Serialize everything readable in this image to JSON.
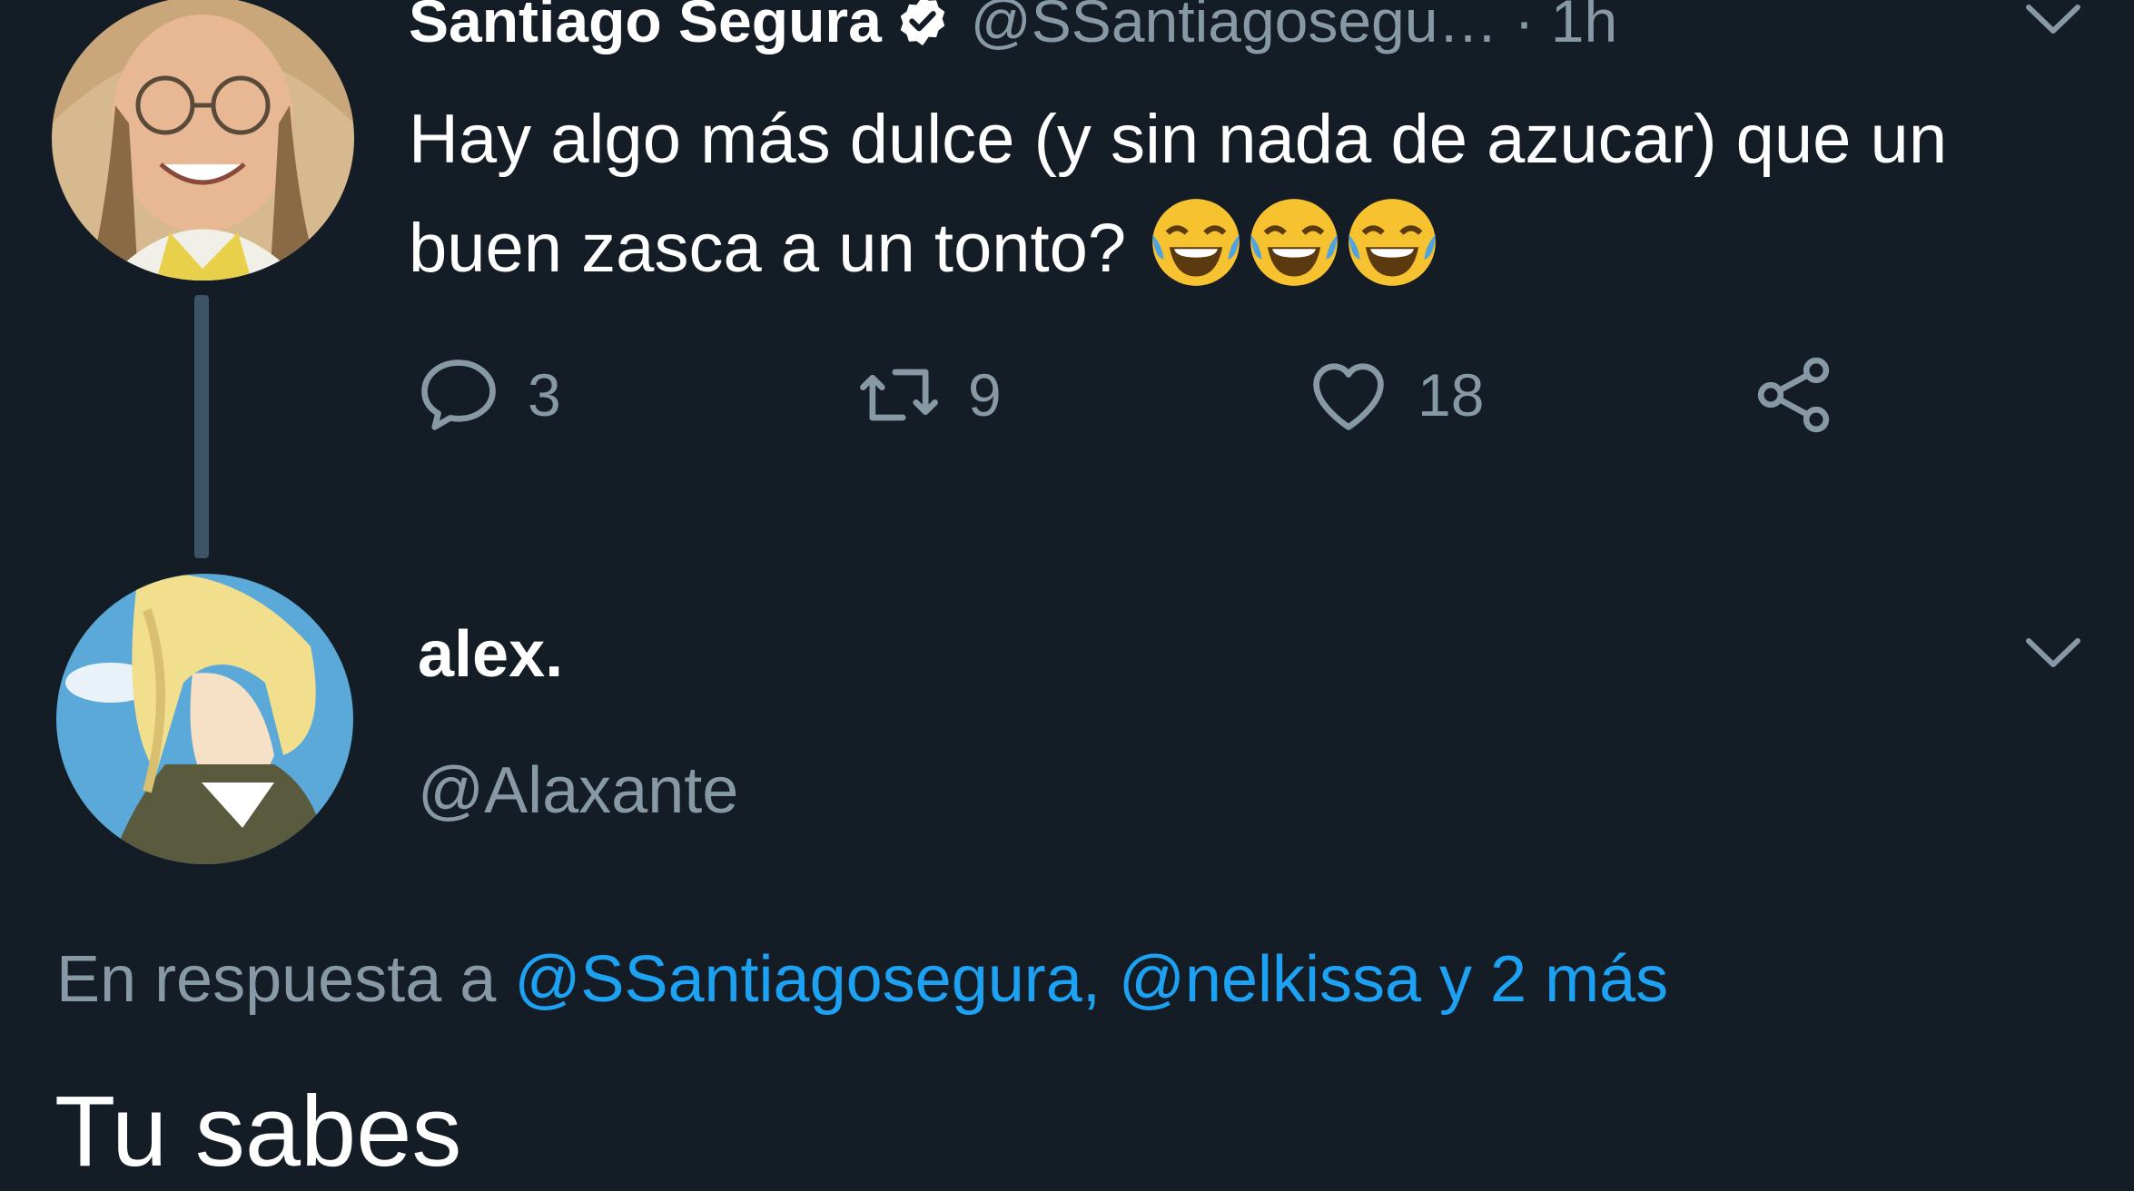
{
  "tweet": {
    "author_name": "Santiago Segura",
    "author_handle": "@SSantiagosegu…",
    "time": "· 1h",
    "text": "Hay algo más dulce (y sin nada de azucar) que un buen zasca a un tonto?",
    "emojis": [
      "face-with-tears-of-joy",
      "face-with-tears-of-joy",
      "face-with-tears-of-joy"
    ],
    "reply_count": "3",
    "retweet_count": "9",
    "like_count": "18"
  },
  "reply": {
    "author_name": "alex.",
    "author_handle": "@Alaxante",
    "reply_prefix": "En respuesta a",
    "reply_mentions": "@SSantiagosegura, @nelkissa y 2 más",
    "text_partial": "Tu sabes"
  },
  "colors": {
    "background": "#141d26",
    "secondary_text": "#8899a6",
    "link": "#1da1f2",
    "thread_line": "#3d5466"
  }
}
